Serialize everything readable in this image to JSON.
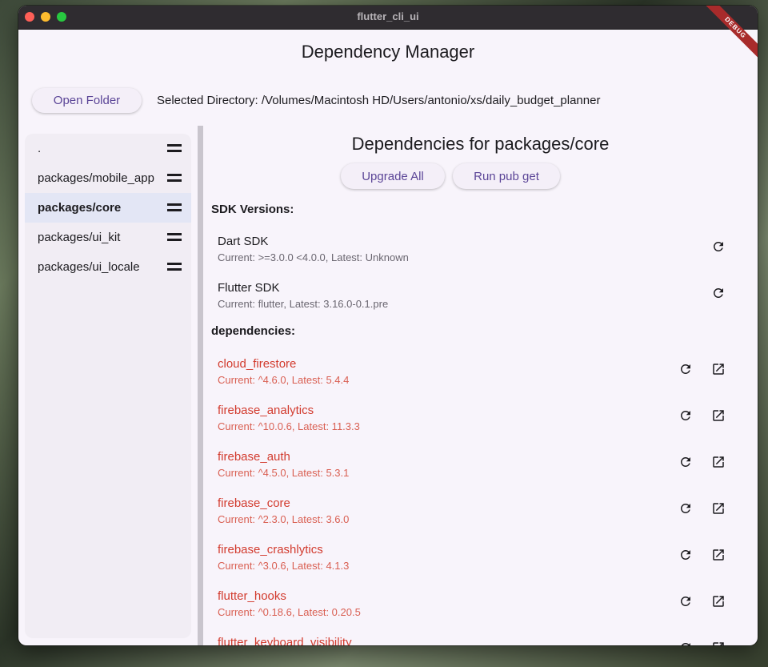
{
  "window": {
    "title": "flutter_cli_ui",
    "debug_label": "DEBUG"
  },
  "app": {
    "title": "Dependency Manager",
    "open_folder_label": "Open Folder",
    "selected_directory": "Selected Directory: /Volumes/Macintosh HD/Users/antonio/xs/daily_budget_planner"
  },
  "sidebar": {
    "items": [
      {
        "label": "."
      },
      {
        "label": "packages/mobile_app"
      },
      {
        "label": "packages/core"
      },
      {
        "label": "packages/ui_kit"
      },
      {
        "label": "packages/ui_locale"
      }
    ],
    "selected": "packages/core"
  },
  "main": {
    "title": "Dependencies for packages/core",
    "upgrade_all_label": "Upgrade All",
    "run_pub_get_label": "Run pub get",
    "sdk_heading": "SDK Versions:",
    "sdks": [
      {
        "name": "Dart SDK",
        "detail": "Current: >=3.0.0 <4.0.0, Latest: Unknown"
      },
      {
        "name": "Flutter SDK",
        "detail": "Current: flutter, Latest: 3.16.0-0.1.pre"
      }
    ],
    "deps_heading": "dependencies:",
    "dependencies": [
      {
        "name": "cloud_firestore",
        "detail": "Current: ^4.6.0, Latest: 5.4.4"
      },
      {
        "name": "firebase_analytics",
        "detail": "Current: ^10.0.6, Latest: 11.3.3"
      },
      {
        "name": "firebase_auth",
        "detail": "Current: ^4.5.0, Latest: 5.3.1"
      },
      {
        "name": "firebase_core",
        "detail": "Current: ^2.3.0, Latest: 3.6.0"
      },
      {
        "name": "firebase_crashlytics",
        "detail": "Current: ^3.0.6, Latest: 4.1.3"
      },
      {
        "name": "flutter_hooks",
        "detail": "Current: ^0.18.6, Latest: 0.20.5"
      },
      {
        "name": "flutter_keyboard_visibility",
        "detail": ""
      }
    ]
  },
  "colors": {
    "outdated": "#d23b2e",
    "accent": "#5b4597"
  },
  "icons": {
    "refresh": "refresh-icon",
    "open_external": "open-in-new-icon",
    "drag": "drag-handle-icon"
  }
}
